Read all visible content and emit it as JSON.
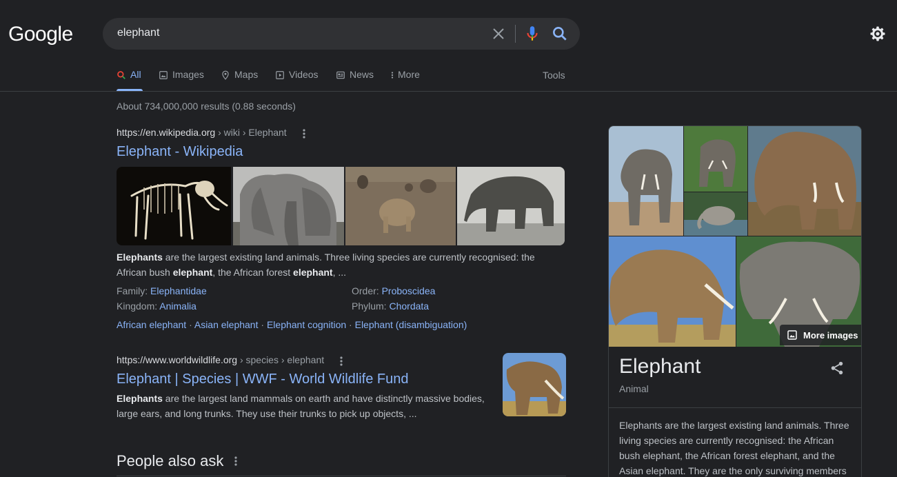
{
  "logo": "Google",
  "search": {
    "query": "elephant"
  },
  "tabs": [
    {
      "label": "All",
      "icon": "search-icon"
    },
    {
      "label": "Images",
      "icon": "image-icon"
    },
    {
      "label": "Maps",
      "icon": "map-pin-icon"
    },
    {
      "label": "Videos",
      "icon": "play-icon"
    },
    {
      "label": "News",
      "icon": "news-icon"
    },
    {
      "label": "More",
      "icon": "more-vert-icon"
    }
  ],
  "tools_label": "Tools",
  "result_stats": "About 734,000,000 results (0.88 seconds)",
  "results": [
    {
      "site": "https://en.wikipedia.org",
      "path": " › wiki › Elephant",
      "title": "Elephant - Wikipedia",
      "snippet_parts": [
        "Elephants",
        " are the largest existing land animals. Three living species are currently recognised: the African bush ",
        "elephant",
        ", the African forest ",
        "elephant",
        ", ..."
      ],
      "facts": [
        {
          "label": "Family: ",
          "value": "Elephantidae"
        },
        {
          "label": "Order: ",
          "value": "Proboscidea"
        },
        {
          "label": "Kingdom: ",
          "value": "Animalia"
        },
        {
          "label": "Phylum: ",
          "value": "Chordata"
        }
      ],
      "sitelinks": [
        "African elephant",
        "Asian elephant",
        "Elephant cognition",
        "Elephant (disambiguation)"
      ],
      "sitelink_separator": " · "
    },
    {
      "site": "https://www.worldwildlife.org",
      "path": " › species › elephant",
      "title": "Elephant | Species | WWF - World Wildlife Fund",
      "snippet_parts": [
        "Elephants",
        " are the largest land mammals on earth and have distinctly massive bodies, large ears, and long trunks. They use their trunks to pick up objects, ..."
      ]
    }
  ],
  "people_also_ask": "People also ask",
  "knowledge_panel": {
    "more_images": "More images",
    "title": "Elephant",
    "subtitle": "Animal",
    "description": "Elephants are the largest existing land animals. Three living species are currently recognised: the African bush elephant, the African forest elephant, and the Asian elephant. They are the only surviving members"
  },
  "colors": {
    "background": "#202124",
    "link": "#8ab4f8",
    "text": "#bdc1c6",
    "searchbox": "#303134"
  }
}
